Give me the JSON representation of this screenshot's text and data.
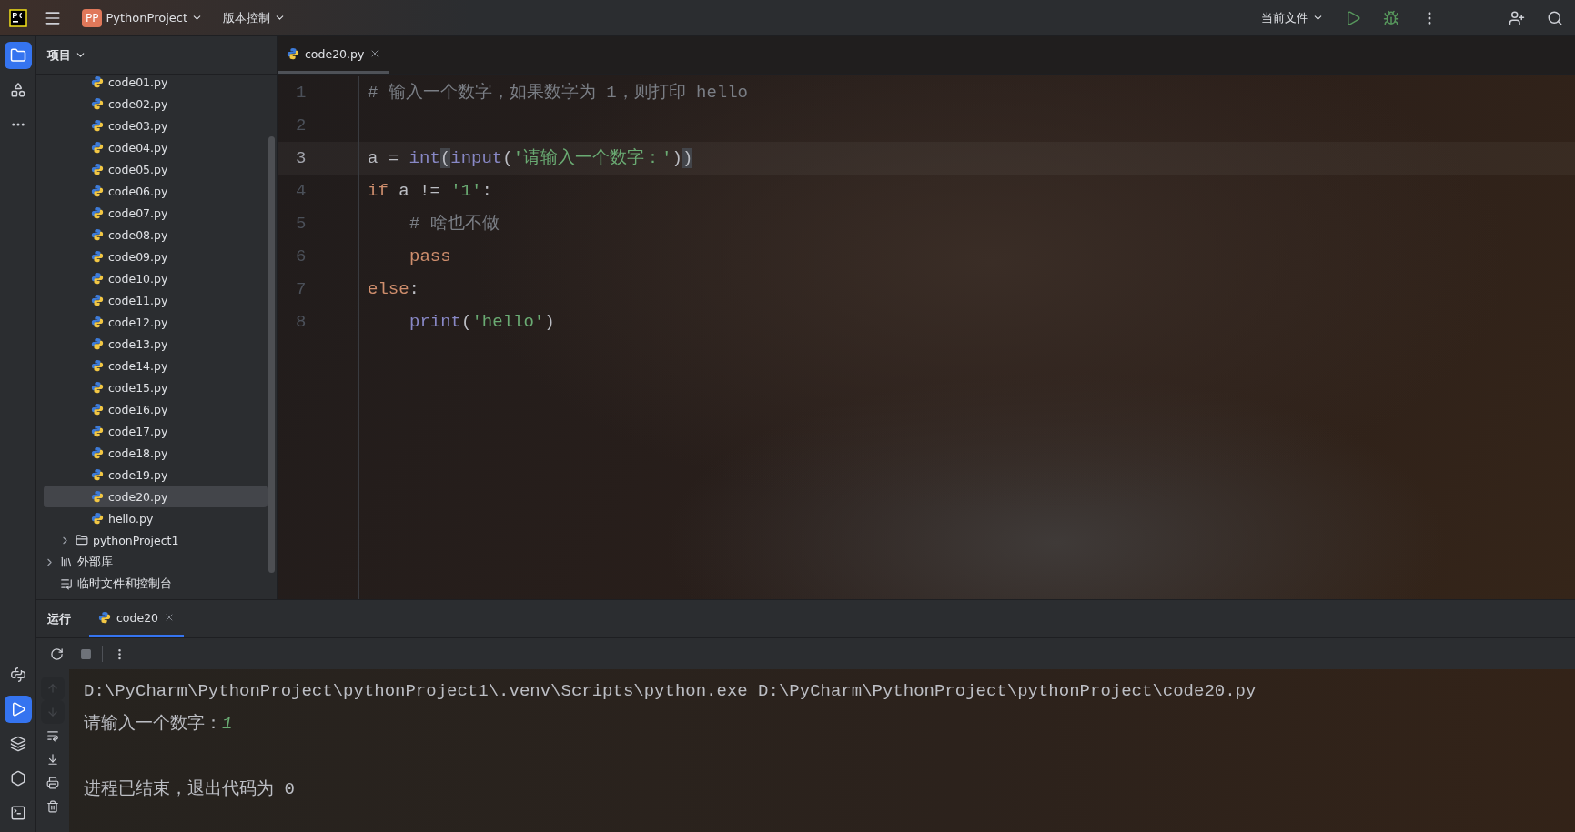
{
  "title_bar": {
    "project_badge": "PP",
    "project": "PythonProject",
    "vcs": "版本控制",
    "run_config": "当前文件"
  },
  "tool_strip": {
    "top": [
      {
        "kind": "folder",
        "selected": true
      },
      {
        "kind": "structure",
        "selected": false
      },
      {
        "kind": "more",
        "selected": false
      }
    ],
    "bottom": [
      {
        "kind": "python",
        "selected": false
      },
      {
        "kind": "run",
        "selected": true
      },
      {
        "kind": "layers",
        "selected": false
      },
      {
        "kind": "services",
        "selected": false
      },
      {
        "kind": "terminal",
        "selected": false
      }
    ]
  },
  "sidebar": {
    "title": "项目",
    "tree": [
      {
        "children": [
          {
            "children": [
              {
                "label": "code01.py",
                "kind": "file",
                "selected": false
              },
              {
                "label": "code02.py",
                "kind": "file",
                "selected": false
              },
              {
                "label": "code03.py",
                "kind": "file",
                "selected": false
              },
              {
                "label": "code04.py",
                "kind": "file",
                "selected": false
              },
              {
                "label": "code05.py",
                "kind": "file",
                "selected": false
              },
              {
                "label": "code06.py",
                "kind": "file",
                "selected": false
              },
              {
                "label": "code07.py",
                "kind": "file",
                "selected": false
              },
              {
                "label": "code08.py",
                "kind": "file",
                "selected": false
              },
              {
                "label": "code09.py",
                "kind": "file",
                "selected": false
              },
              {
                "label": "code10.py",
                "kind": "file",
                "selected": false
              },
              {
                "label": "code11.py",
                "kind": "file",
                "selected": false
              },
              {
                "label": "code12.py",
                "kind": "file",
                "selected": false
              },
              {
                "label": "code13.py",
                "kind": "file",
                "selected": false
              },
              {
                "label": "code14.py",
                "kind": "file",
                "selected": false
              },
              {
                "label": "code15.py",
                "kind": "file",
                "selected": false
              },
              {
                "label": "code16.py",
                "kind": "file",
                "selected": false
              },
              {
                "label": "code17.py",
                "kind": "file",
                "selected": false
              },
              {
                "label": "code18.py",
                "kind": "file",
                "selected": false
              },
              {
                "label": "code19.py",
                "kind": "file",
                "selected": false
              },
              {
                "label": "code20.py",
                "kind": "file",
                "selected": true
              },
              {
                "label": "hello.py",
                "kind": "file",
                "selected": false
              }
            ]
          },
          {
            "label": "pythonProject1",
            "kind": "folder",
            "selected": false,
            "expanded": false
          }
        ]
      },
      {
        "label": "外部库",
        "kind": "library",
        "selected": false,
        "expanded": false
      },
      {
        "label": "临时文件和控制台",
        "kind": "scratch",
        "selected": false
      }
    ]
  },
  "editor": {
    "tabs": [
      {
        "label": "code20.py",
        "selected": true
      }
    ],
    "lines": [
      {
        "number": "1",
        "current": false,
        "tokens": [
          {
            "kind": "comment",
            "text": "# 输入一个数字，如果数字为 1，则打印 hello"
          }
        ]
      },
      {
        "number": "2",
        "current": false
      },
      {
        "number": "3",
        "current": true,
        "tokens": [
          {
            "kind": "plain",
            "text": "a = "
          },
          {
            "kind": "builtin",
            "text": "int"
          },
          {
            "kind": "paren",
            "text": "(",
            "highlighted": true
          },
          {
            "kind": "builtin",
            "text": "input"
          },
          {
            "kind": "paren",
            "text": "(",
            "highlighted": false
          },
          {
            "kind": "string",
            "text": "'请输入一个数字：'"
          },
          {
            "kind": "paren",
            "text": ")",
            "highlighted": false
          },
          {
            "kind": "paren",
            "text": ")",
            "highlighted": true
          }
        ]
      },
      {
        "number": "4",
        "current": false,
        "tokens": [
          {
            "kind": "keyword",
            "text": "if"
          },
          {
            "kind": "plain",
            "text": " a != "
          },
          {
            "kind": "string",
            "text": "'1'"
          },
          {
            "kind": "plain",
            "text": ":"
          }
        ]
      },
      {
        "number": "5",
        "current": false,
        "indented": true,
        "tokens": [
          {
            "kind": "comment",
            "text": "# 啥也不做"
          }
        ]
      },
      {
        "number": "6",
        "current": false,
        "indented": true,
        "tokens": [
          {
            "kind": "keyword",
            "text": "pass"
          }
        ]
      },
      {
        "number": "7",
        "current": false,
        "tokens": [
          {
            "kind": "keyword",
            "text": "else"
          },
          {
            "kind": "plain",
            "text": ":"
          }
        ]
      },
      {
        "number": "8",
        "current": false,
        "indented": true,
        "tokens": [
          {
            "kind": "builtin",
            "text": "print"
          },
          {
            "kind": "paren",
            "text": "(",
            "highlighted": false
          },
          {
            "kind": "string",
            "text": "'hello'"
          },
          {
            "kind": "paren",
            "text": ")",
            "highlighted": false
          }
        ]
      }
    ]
  },
  "run_panel": {
    "title": "运行",
    "tabs": [
      {
        "label": "code20",
        "selected": true
      }
    ],
    "side_tools": [
      {
        "kind": "up",
        "disabled": true
      },
      {
        "kind": "down",
        "disabled": true
      },
      {
        "kind": "wrap",
        "disabled": false
      },
      {
        "kind": "scroll-end",
        "disabled": false
      },
      {
        "kind": "print",
        "disabled": false
      },
      {
        "kind": "trash",
        "disabled": false
      }
    ],
    "console": [
      {
        "kind": "command",
        "text": "D:\\PyCharm\\PythonProject\\pythonProject1\\.venv\\Scripts\\python.exe D:\\PyCharm\\PythonProject\\pythonProject\\code20.py"
      },
      {
        "kind": "prompt",
        "text": "请输入一个数字：",
        "input": "1"
      },
      {
        "kind": "exit",
        "text": "进程已结束，退出代码为 0"
      }
    ]
  }
}
